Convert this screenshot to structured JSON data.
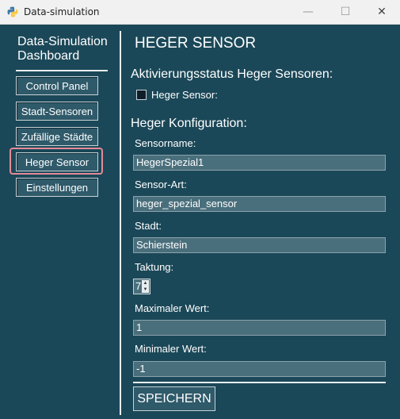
{
  "window": {
    "title": "Data-simulation",
    "controls": {
      "minimize": "—",
      "maximize": "☐",
      "close": "✕"
    }
  },
  "sidebar": {
    "title_line1": "Data-Simulation",
    "title_line2": "Dashboard",
    "items": [
      {
        "label": "Control Panel"
      },
      {
        "label": "Stadt-Sensoren"
      },
      {
        "label": "Zufällige Städte"
      },
      {
        "label": "Heger Sensor",
        "selected": true
      },
      {
        "label": "Einstellungen"
      }
    ]
  },
  "main": {
    "title": "HEGER SENSOR",
    "activation_heading": "Aktivierungsstatus Heger Sensoren:",
    "checkbox_label": "Heger Sensor:",
    "config_heading": "Heger Konfiguration:",
    "fields": {
      "sensorname": {
        "label": "Sensorname:",
        "value": "HegerSpezial1"
      },
      "sensor_art": {
        "label": "Sensor-Art:",
        "value": "heger_spezial_sensor"
      },
      "stadt": {
        "label": "Stadt:",
        "value": "Schierstein"
      },
      "taktung": {
        "label": "Taktung:",
        "value": "7"
      },
      "max": {
        "label": "Maximaler Wert:",
        "value": "1"
      },
      "min": {
        "label": "Minimaler Wert:",
        "value": "-1"
      }
    },
    "save_label": "SPEICHERN"
  },
  "colors": {
    "background": "#1b4858",
    "input_bg": "#4a6f7c",
    "highlight": "#e58a96"
  }
}
